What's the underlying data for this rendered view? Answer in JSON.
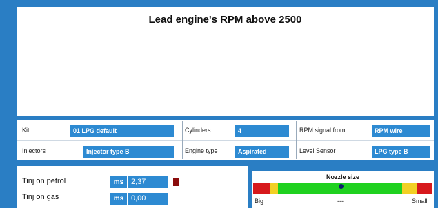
{
  "message": {
    "title": "Lead engine's RPM above 2500"
  },
  "params": {
    "kit_label": "Kit",
    "kit_value": "01 LPG default",
    "cylinders_label": "Cylinders",
    "cylinders_value": "4",
    "rpm_signal_label": "RPM signal from",
    "rpm_signal_value": "RPM wire",
    "injectors_label": "Injectors",
    "injectors_value": "Injector type B",
    "engine_type_label": "Engine type",
    "engine_type_value": "Aspirated",
    "level_sensor_label": "Level Sensor",
    "level_sensor_value": "LPG type B"
  },
  "tinj": {
    "petrol_label": "Tinj on petrol",
    "petrol_unit": "ms",
    "petrol_value": "2,37",
    "gas_label": "Tinj on gas",
    "gas_unit": "ms",
    "gas_value": "0,00",
    "petrol_indicator_color": "#8b0d0d"
  },
  "nozzle": {
    "title": "Nozzle size",
    "left_label": "Big",
    "center_label": "---",
    "right_label": "Small",
    "colors": {
      "red": "#d7191c",
      "yellow": "#f2d024",
      "green": "#1fd11f",
      "marker": "#0d1f6b"
    }
  },
  "colors": {
    "frame": "#2a7ec4",
    "field": "#2d8ad2"
  }
}
